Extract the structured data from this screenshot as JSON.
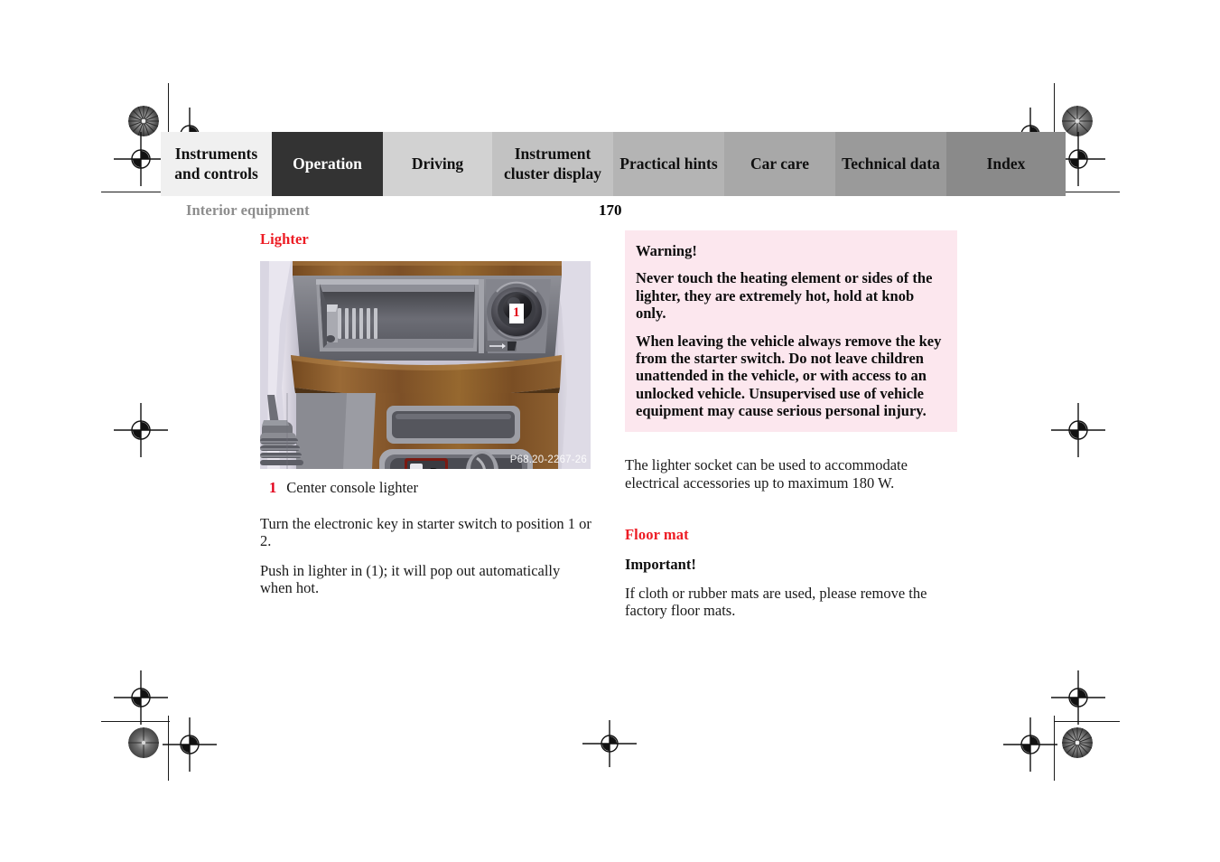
{
  "runhead": {
    "section": "Interior equipment",
    "page_number": "170"
  },
  "tabs": [
    {
      "label": "Instruments and controls",
      "active": false,
      "bg": "#f0f0f0"
    },
    {
      "label": "Operation",
      "active": true,
      "bg": "#333333"
    },
    {
      "label": "Driving",
      "active": false,
      "bg": "#d2d2d2"
    },
    {
      "label": "Instrument cluster display",
      "active": false,
      "bg": "#c2c2c2"
    },
    {
      "label": "Practical hints",
      "active": false,
      "bg": "#b4b4b4"
    },
    {
      "label": "Car care",
      "active": false,
      "bg": "#a8a8a8"
    },
    {
      "label": "Technical data",
      "active": false,
      "bg": "#9a9a9a"
    },
    {
      "label": "Index",
      "active": false,
      "bg": "#8a8a8a"
    }
  ],
  "left_column": {
    "heading": "Lighter",
    "figure": {
      "code": "P68.20-2267-26",
      "callout_number": "1"
    },
    "caption": {
      "number": "1",
      "text": "Center console lighter"
    },
    "paragraphs": [
      "Turn the electronic key in starter switch to position 1 or 2.",
      "Push in lighter in (1); it will pop out automatically when hot."
    ]
  },
  "right_column": {
    "warning": {
      "title": "Warning!",
      "paragraphs": [
        "Never touch the heating element or sides of the lighter, they are extremely hot, hold at knob only.",
        "When leaving the vehicle always remove the key from the starter switch. Do not leave children unattended in the vehicle, or with access to an unlocked vehicle. Unsupervised use of vehicle equipment may cause serious personal injury."
      ]
    },
    "socket_note": "The lighter socket can be used to accommodate electrical accessories up to maximum 180 W.",
    "floor_mat": {
      "heading": "Floor mat",
      "important_label": "Important!",
      "body": "If cloth or rubber mats are used, please remove the factory floor mats."
    }
  },
  "colors": {
    "accent_red": "#ed1c24",
    "warning_bg": "#fce7ee",
    "runhead_gray": "#8d8d8d"
  }
}
